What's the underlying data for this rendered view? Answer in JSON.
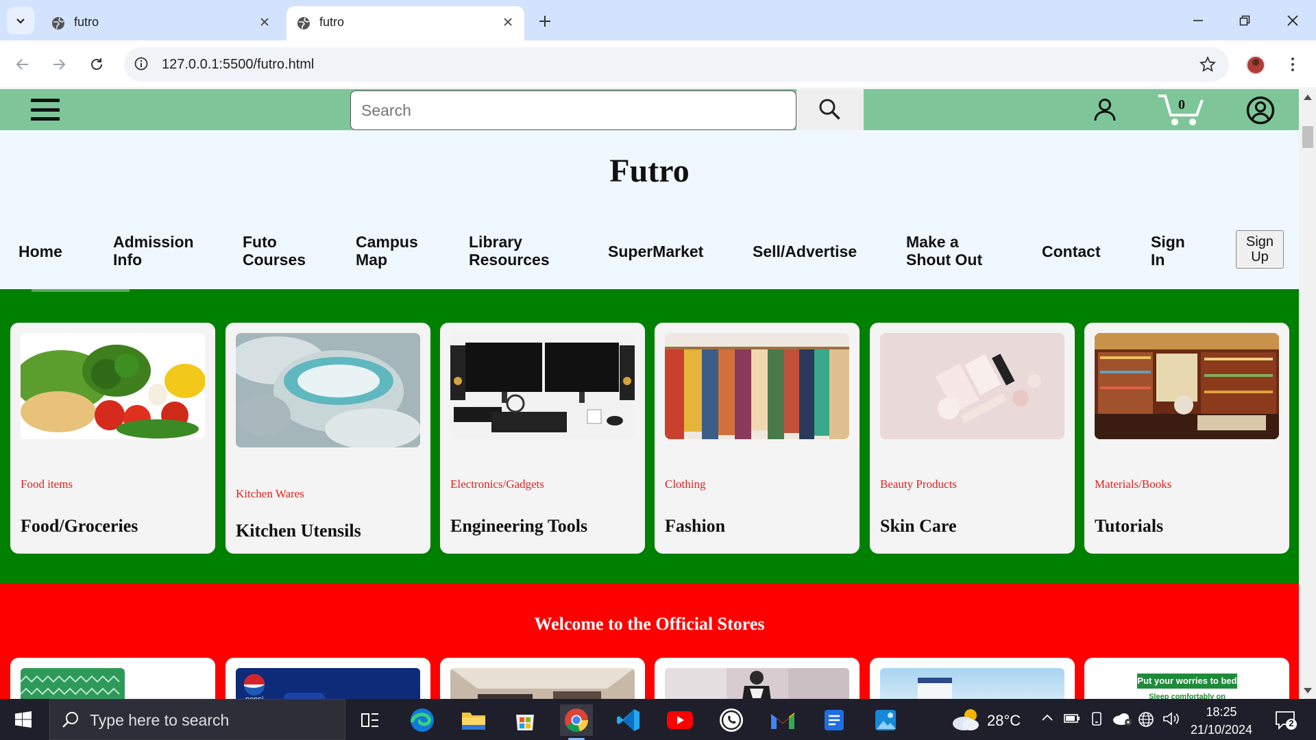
{
  "browser": {
    "tabs": [
      {
        "title": "futro",
        "active": false
      },
      {
        "title": "futro",
        "active": true
      }
    ],
    "address": "127.0.0.1:5500/futro.html"
  },
  "header": {
    "search_placeholder": "Search",
    "cart_count": "0"
  },
  "site": {
    "brand": "Futro",
    "nav": [
      {
        "line1": "Home",
        "line2": ""
      },
      {
        "line1": "Admission",
        "line2": "Info"
      },
      {
        "line1": "Futo",
        "line2": "Courses"
      },
      {
        "line1": "Campus",
        "line2": "Map"
      },
      {
        "line1": "Library",
        "line2": "Resources"
      },
      {
        "line1": "SuperMarket",
        "line2": ""
      },
      {
        "line1": "Sell/Advertise",
        "line2": ""
      },
      {
        "line1": "Make a",
        "line2": "Shout Out"
      },
      {
        "line1": "Contact",
        "line2": ""
      },
      {
        "line1": "Sign",
        "line2": "In"
      }
    ],
    "signup": {
      "line1": "Sign",
      "line2": "Up"
    }
  },
  "categories": [
    {
      "category": "Food items",
      "name": "Food/Groceries",
      "image": "vegetables"
    },
    {
      "category": "Kitchen Wares",
      "name": "Kitchen Utensils",
      "image": "steel-pots"
    },
    {
      "category": "Electronics/Gadgets",
      "name": "Engineering Tools",
      "image": "computer-monitors"
    },
    {
      "category": "Clothing",
      "name": "Fashion",
      "image": "clothes-rack"
    },
    {
      "category": "Beauty Products",
      "name": "Skin Care",
      "image": "cosmetics"
    },
    {
      "category": "Materials/Books",
      "name": "Tutorials",
      "image": "bookstore"
    }
  ],
  "official_stores": {
    "heading": "Welcome to the Official Stores",
    "stores": [
      {
        "image": "green-pattern"
      },
      {
        "image": "pepsi",
        "logo_text": "pepsi"
      },
      {
        "image": "interior"
      },
      {
        "image": "fashion-display"
      },
      {
        "image": "skincare-bottle"
      },
      {
        "image": "mattress",
        "banner_text": "Put your worries to bed",
        "sub_text": "Sleep comfortably on"
      }
    ]
  },
  "taskbar": {
    "search_placeholder": "Type here to search",
    "weather_temp": "28°C",
    "time": "18:25",
    "date": "21/10/2024",
    "notification_count": "2"
  },
  "colors": {
    "topbar": "#7ec699",
    "categories_bg": "#008000",
    "stores_bg": "#ff0000",
    "category_label": "#e02020",
    "page_bg": "#f0f8ff"
  }
}
